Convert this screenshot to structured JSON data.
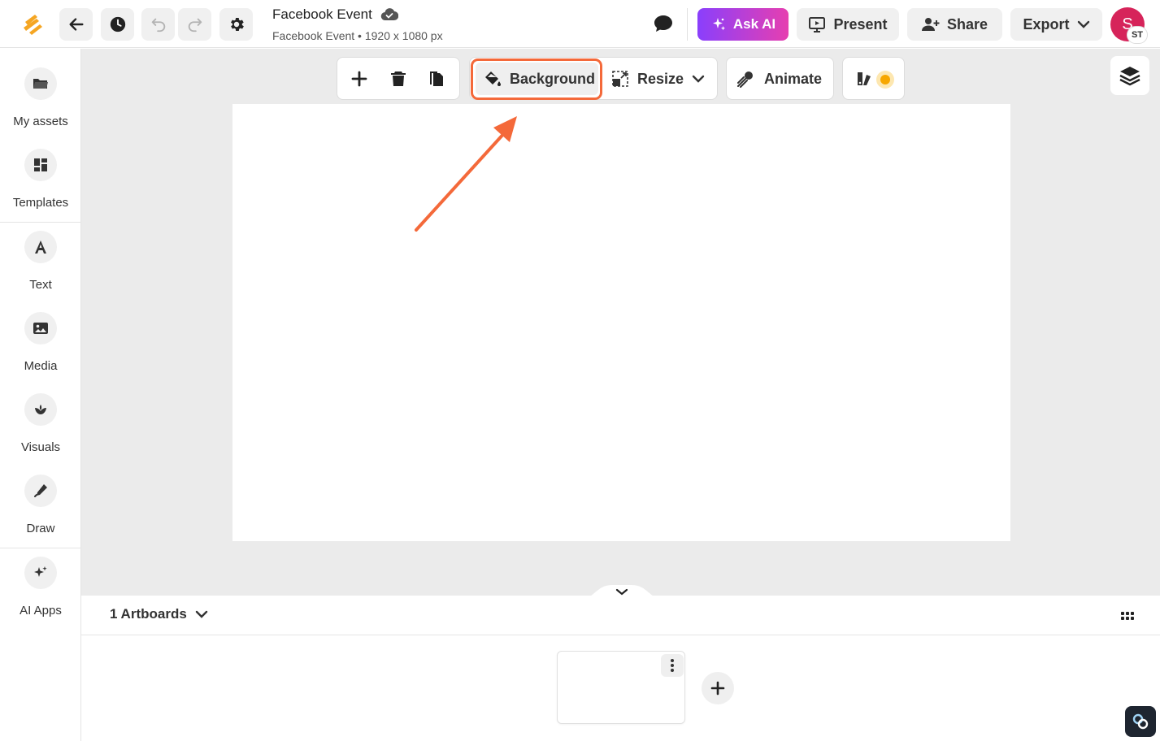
{
  "header": {
    "doc_title": "Facebook Event",
    "doc_subtitle": "Facebook Event • 1920 x 1080 px",
    "ask_ai_label": "Ask AI",
    "present_label": "Present",
    "share_label": "Share",
    "export_label": "Export",
    "avatar_initial": "S",
    "avatar_badge": "ST"
  },
  "sidebar": {
    "items": [
      {
        "label": "My assets",
        "icon": "folder-icon"
      },
      {
        "label": "Templates",
        "icon": "templates-icon"
      },
      {
        "label": "Text",
        "icon": "text-icon"
      },
      {
        "label": "Media",
        "icon": "image-icon"
      },
      {
        "label": "Visuals",
        "icon": "visuals-icon"
      },
      {
        "label": "Draw",
        "icon": "pen-icon"
      },
      {
        "label": "AI Apps",
        "icon": "sparkle-icon"
      }
    ]
  },
  "toolbar": {
    "background_label": "Background",
    "resize_label": "Resize",
    "animate_label": "Animate"
  },
  "bottom": {
    "artboards_label": "1 Artboards"
  },
  "colors": {
    "accent_orange": "#f4693a",
    "ask_ai_gradient_start": "#8a3ffc",
    "ask_ai_gradient_end": "#e63fb0",
    "avatar": "#d6245a"
  }
}
